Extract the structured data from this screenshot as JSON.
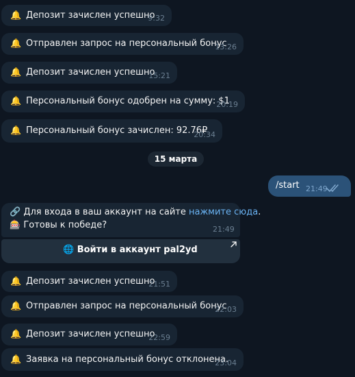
{
  "messages_before": [
    {
      "text": "Депозит зачислен успешно",
      "time": "9:32",
      "icon": "bell-icon"
    },
    {
      "text": "Отправлен запрос на персональный бонус",
      "time": "13:26",
      "icon": "bell-icon"
    },
    {
      "text": "Депозит зачислен успешно",
      "time": "15:21",
      "icon": "bell-icon"
    },
    {
      "text": "Персональный бонус одобрен на сумму: $1",
      "time": "20:19",
      "icon": "bell-icon"
    },
    {
      "text": "Персональный бонус зачислен: 92.76₽",
      "time": "20:34",
      "icon": "bell-icon"
    }
  ],
  "date_separator": "15 марта",
  "outgoing": {
    "text": "/start",
    "time": "21:49"
  },
  "login_message": {
    "prefix": "Для входа в ваш аккаунт на сайте ",
    "link_text": "нажмите сюда",
    "suffix": ".",
    "line2": "Готовы к победе?",
    "time": "21:49"
  },
  "login_button": {
    "label": "Войти в аккаунт pal2yd",
    "icon": "globe-icon"
  },
  "messages_after": [
    {
      "text": "Депозит зачислен успешно",
      "time": "21:51",
      "icon": "bell-icon"
    },
    {
      "text": "Отправлен запрос на персональный бонус",
      "time": "22:03",
      "icon": "bell-icon"
    },
    {
      "text": "Депозит зачислен успешно",
      "time": "22:59",
      "icon": "bell-icon"
    },
    {
      "text": "Заявка на персональный бонус отклонена.",
      "time": "23:04",
      "icon": "bell-icon"
    }
  ],
  "colors": {
    "background": "#0e1621",
    "incoming_bubble": "#182533",
    "outgoing_bubble": "#2b5278",
    "link": "#6ab3f3",
    "inline_button": "#22303e"
  }
}
